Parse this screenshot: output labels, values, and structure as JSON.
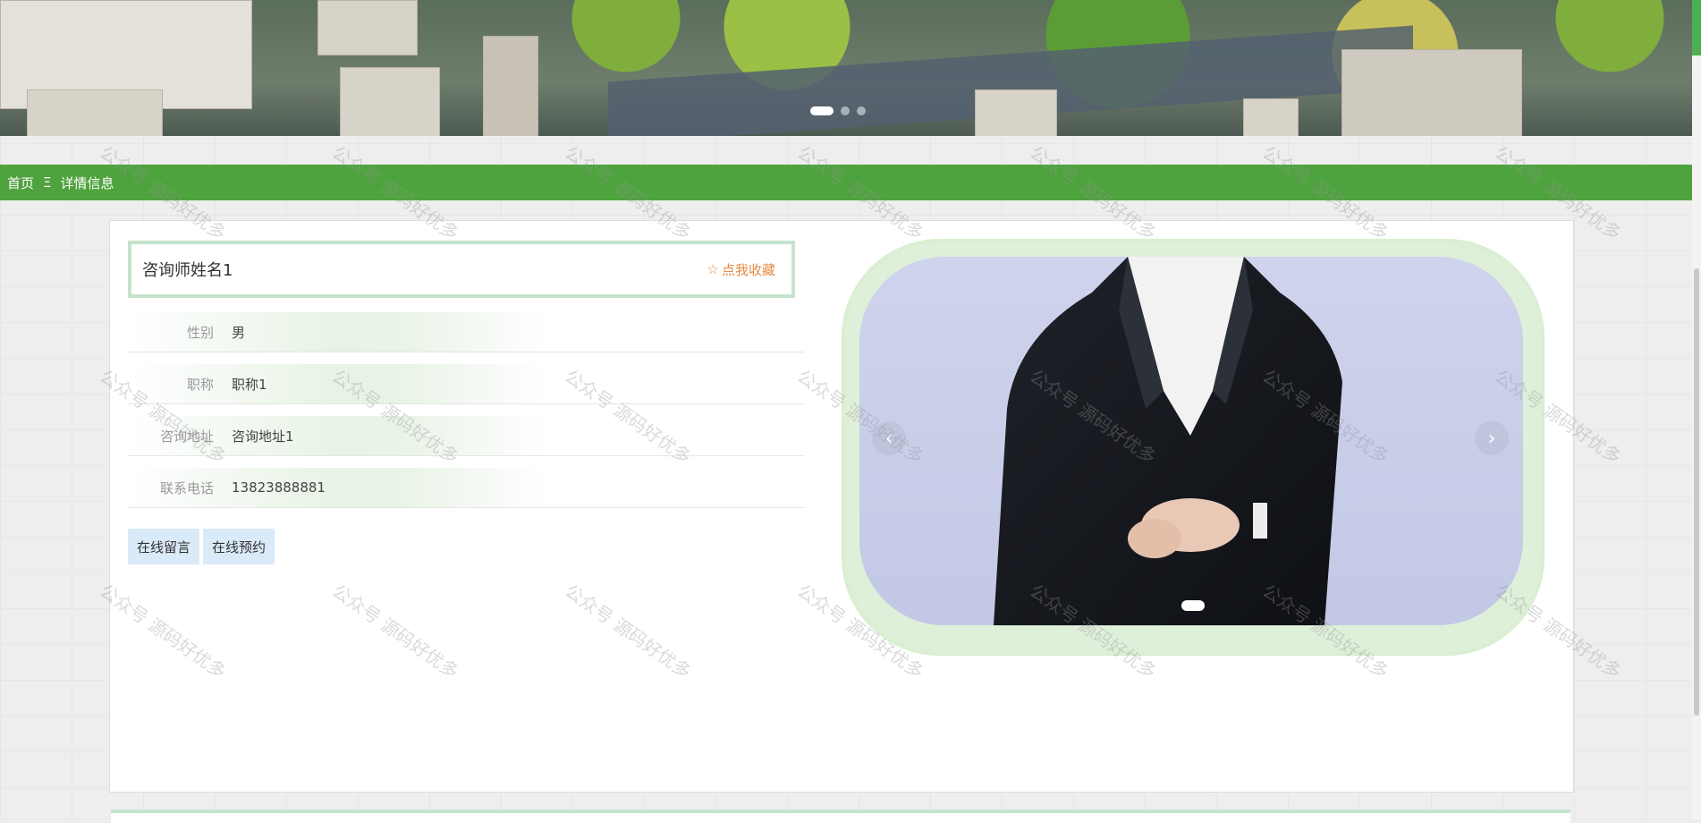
{
  "banner": {
    "carousel_dots": 3,
    "active_dot": 1
  },
  "breadcrumb": {
    "home": "首页",
    "separator": "Ξ",
    "current": "详情信息"
  },
  "detail": {
    "name": "咨询师姓名1",
    "favorite_label": "点我收藏",
    "fields": [
      {
        "label": "性别",
        "value": "男"
      },
      {
        "label": "职称",
        "value": "职称1"
      },
      {
        "label": "咨询地址",
        "value": "咨询地址1"
      },
      {
        "label": "联系电话",
        "value": "13823888881"
      }
    ],
    "buttons": {
      "message": "在线留言",
      "appointment": "在线预约"
    }
  },
  "gallery": {
    "prev_icon": "‹",
    "next_icon": "›",
    "dots": 1
  },
  "watermark_text": "公众号 源码好优多",
  "colors": {
    "accent_green": "#4fa33e",
    "favorite_orange": "#e78a45",
    "button_bg": "#dbeaf8",
    "frame_green": "#dff0da"
  }
}
